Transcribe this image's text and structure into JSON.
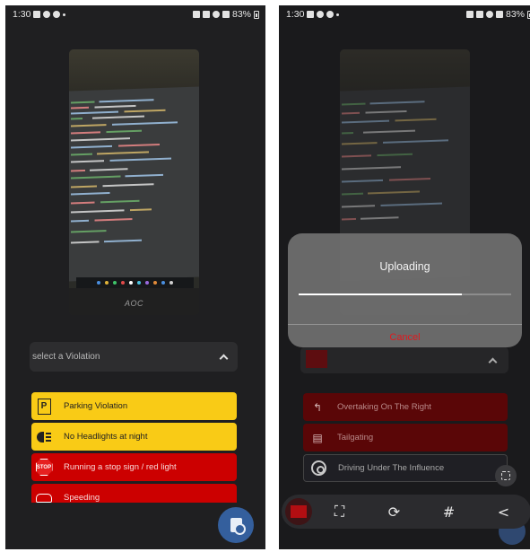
{
  "left_screen": {
    "status": {
      "time": "1:30",
      "battery": "83%"
    },
    "select": {
      "placeholder": "select a Violation"
    },
    "violations": [
      {
        "label": "Parking Violation",
        "icon": "parking-sign-icon",
        "color": "#f9cb16"
      },
      {
        "label": "No Headlights at night",
        "icon": "headlight-icon",
        "color": "#f9cb16"
      },
      {
        "label": "Running a stop sign / red light",
        "icon": "stop-sign-icon",
        "color": "#cc0000",
        "icon_text": "STOP"
      },
      {
        "label": "Speeding",
        "icon": "speed-car-icon",
        "color": "#cc0000"
      }
    ],
    "photo_brand": "AOC"
  },
  "right_screen": {
    "status": {
      "time": "1:30",
      "battery": "83%"
    },
    "dialog": {
      "title": "Uploading",
      "progress": 0.77,
      "cancel_label": "Cancel"
    },
    "violations": [
      {
        "label": "Overtaking On The Right",
        "icon": "overtake-arrow-icon"
      },
      {
        "label": "Tailgating",
        "icon": "tailgating-cars-icon"
      },
      {
        "label": "Driving Under The Influence",
        "icon": "steering-wheel-icon"
      }
    ],
    "toolbar": [
      {
        "name": "scan-icon",
        "glyph": "⛶"
      },
      {
        "name": "rotate-edit-icon",
        "glyph": "⟳"
      },
      {
        "name": "hashtag-icon",
        "glyph": "#"
      },
      {
        "name": "share-icon",
        "glyph": "<"
      }
    ]
  },
  "colors": {
    "accent": "#345f9d",
    "warning": "#f9cb16",
    "danger": "#cc0000"
  }
}
